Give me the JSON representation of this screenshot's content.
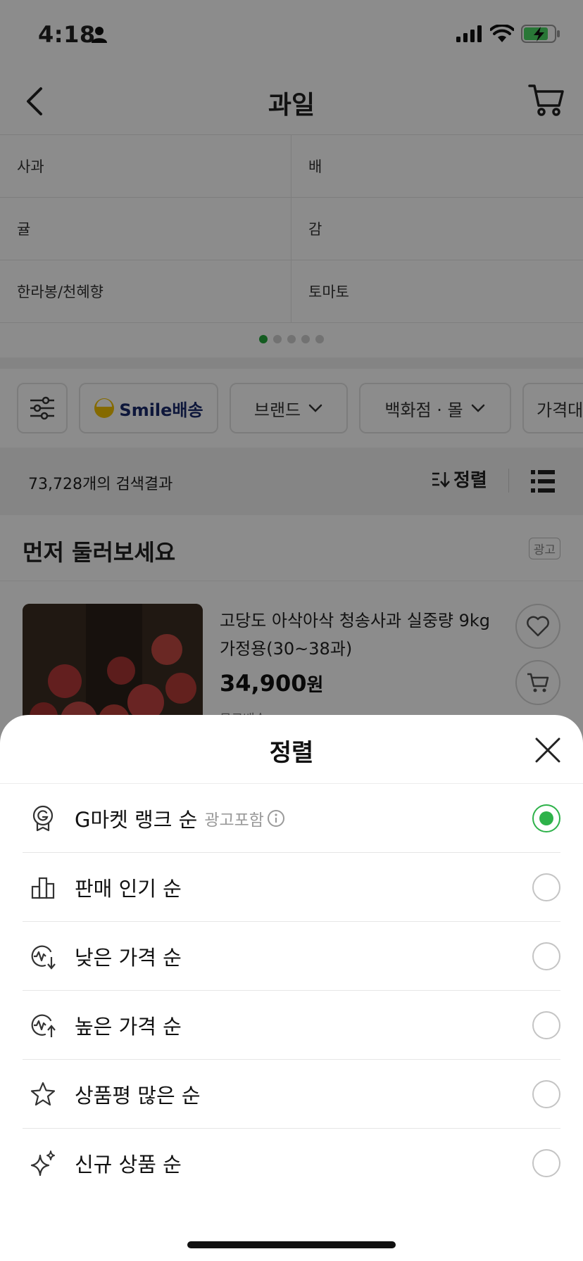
{
  "status": {
    "time": "4:18"
  },
  "nav": {
    "title": "과일"
  },
  "categories": [
    [
      "사과",
      "배"
    ],
    [
      "귤",
      "감"
    ],
    [
      "한라봉/천혜향",
      "토마토"
    ]
  ],
  "filters": {
    "smile_label": "Smile배송",
    "brand": "브랜드",
    "department": "백화점 · 몰",
    "price": "가격대"
  },
  "results": {
    "count": "73,728개의 검색결과",
    "sort_label": "정렬"
  },
  "section": {
    "title": "먼저 둘러보세요",
    "ad_badge": "광고"
  },
  "product": {
    "name": "고당도 아삭아삭 청송사과 실중량 9kg가정용(30~38과)",
    "price": "34,900",
    "price_unit": "원",
    "sub": "무료배송"
  },
  "sheet": {
    "title": "정렬",
    "options": [
      {
        "label": "G마켓 랭크 순",
        "note": "광고포함",
        "selected": true,
        "icon": "medal-g-icon"
      },
      {
        "label": "판매 인기 순",
        "note": "",
        "selected": false,
        "icon": "bar-chart-icon"
      },
      {
        "label": "낮은 가격 순",
        "note": "",
        "selected": false,
        "icon": "price-down-icon"
      },
      {
        "label": "높은 가격 순",
        "note": "",
        "selected": false,
        "icon": "price-up-icon"
      },
      {
        "label": "상품평 많은 순",
        "note": "",
        "selected": false,
        "icon": "star-icon"
      },
      {
        "label": "신규 상품 순",
        "note": "",
        "selected": false,
        "icon": "sparkle-icon"
      }
    ]
  },
  "colors": {
    "accent_green": "#2eb24a",
    "smile_navy": "#1a2a6c",
    "smile_yellow": "#f2c200"
  }
}
